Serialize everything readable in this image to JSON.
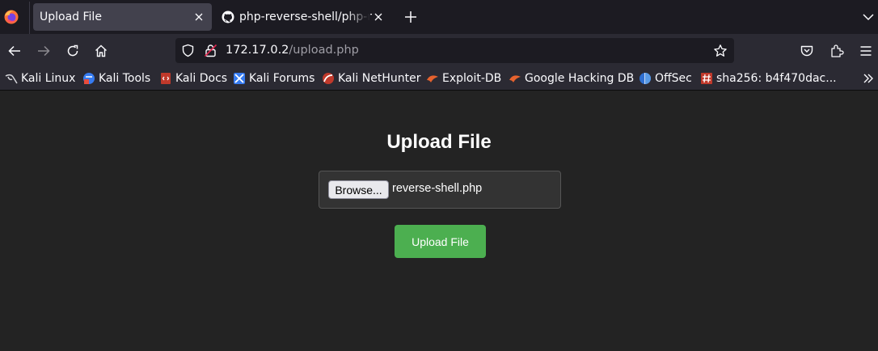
{
  "tabs": [
    {
      "label": "Upload File",
      "active": true
    },
    {
      "label": "php-reverse-shell/php-reverse-shell.php",
      "active": false
    }
  ],
  "address": {
    "host": "172.17.0.2",
    "path": "/upload.php"
  },
  "bookmarks": [
    {
      "label": "Kali Linux",
      "icon": "kali-dragon-icon"
    },
    {
      "label": "Kali Tools",
      "icon": "kali-tools-icon"
    },
    {
      "label": "Kali Docs",
      "icon": "kali-docs-icon"
    },
    {
      "label": "Kali Forums",
      "icon": "kali-forums-icon"
    },
    {
      "label": "Kali NetHunter",
      "icon": "kali-nethunter-icon"
    },
    {
      "label": "Exploit-DB",
      "icon": "exploit-db-icon"
    },
    {
      "label": "Google Hacking DB",
      "icon": "ghdb-icon"
    },
    {
      "label": "OffSec",
      "icon": "offsec-icon"
    },
    {
      "label": "sha256: b4f470dac...",
      "icon": "hash-icon"
    }
  ],
  "page": {
    "title": "Upload File",
    "browse_label": "Browse...",
    "file_name": "reverse-shell.php",
    "submit_label": "Upload File"
  },
  "colors": {
    "submit_button": "#4caf50",
    "page_background": "#232323",
    "tab_active": "#42414d"
  }
}
